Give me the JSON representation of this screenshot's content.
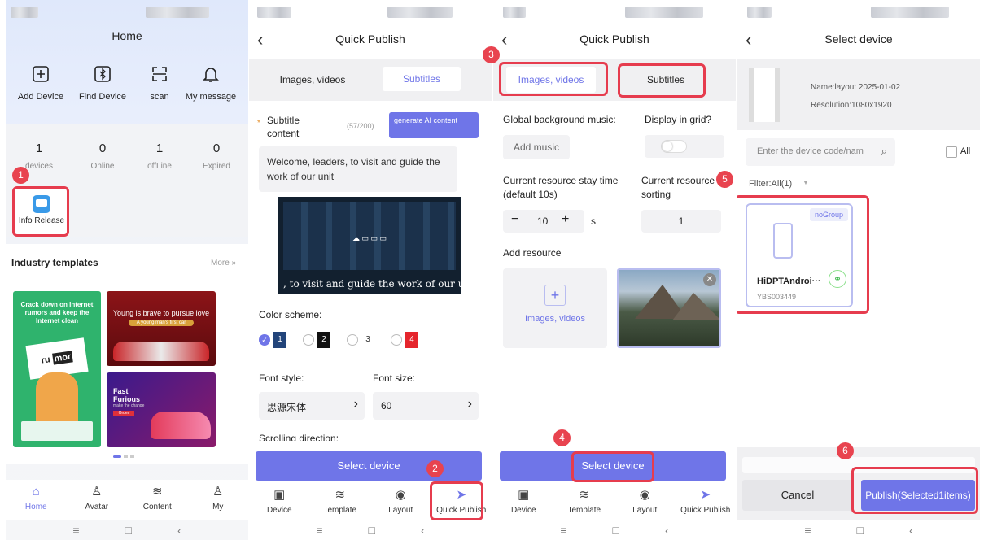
{
  "screen1": {
    "title": "Home",
    "actions": [
      {
        "label": "Add Device",
        "icon": "plus-square-icon"
      },
      {
        "label": "Find Device",
        "icon": "bluetooth-icon"
      },
      {
        "label": "scan",
        "icon": "scan-icon"
      },
      {
        "label": "My message",
        "icon": "bell-icon"
      }
    ],
    "stats": [
      {
        "value": "1",
        "label": "devices"
      },
      {
        "value": "0",
        "label": "Online"
      },
      {
        "value": "1",
        "label": "offLine"
      },
      {
        "value": "0",
        "label": "Expired"
      }
    ],
    "info_release": "Info Release",
    "industry_templates": "Industry templates",
    "more": "More »",
    "template1_text": "Crack down on Internet rumors and keep the Internet clean",
    "template1_word1": "ru",
    "template1_word2": "mor",
    "template2_text": "Young is brave to pursue love",
    "template2_sub": "A young man's first car",
    "template3_text1": "Fast",
    "template3_text2": "Furious",
    "template3_sub": "make the change",
    "template3_btn": "Order",
    "tabs": [
      "Home",
      "Avatar",
      "Content",
      "My"
    ]
  },
  "screen2": {
    "title": "Quick Publish",
    "tab_images": "Images, videos",
    "tab_subtitles": "Subtitles",
    "subtitle_label": "Subtitle content",
    "char_count": "(57/200)",
    "ai_button": "generate AI content",
    "subtitle_text": "Welcome, leaders, to visit and guide the work of our unit",
    "preview_caption": ", to visit and guide the work of our uni",
    "color_scheme": "Color scheme:",
    "color_options": [
      "1",
      "2",
      "3",
      "4"
    ],
    "font_style_label": "Font style:",
    "font_style_value": "思源宋体",
    "font_size_label": "Font size:",
    "font_size_value": "60",
    "scrolling_label": "Scrolling direction:",
    "select_device": "Select device",
    "tabs": [
      "Device",
      "Template",
      "Layout",
      "Quick Publish"
    ]
  },
  "screen3": {
    "title": "Quick Publish",
    "tab_images": "Images, videos",
    "tab_subtitles": "Subtitles",
    "bg_music": "Global background music:",
    "add_music": "Add music",
    "display_grid": "Display in grid?",
    "stay_time": "Current resource stay time (default 10s)",
    "stay_value": "10",
    "stay_unit": "s",
    "sorting": "Current resource sorting",
    "sorting_value": "1",
    "add_resource": "Add resource",
    "upload_label": "Images, videos",
    "select_device": "Select device",
    "tabs": [
      "Device",
      "Template",
      "Layout",
      "Quick Publish"
    ]
  },
  "screen4": {
    "title": "Select device",
    "layout_name": "Name:layout 2025-01-02",
    "resolution": "Resolution:1080x1920",
    "search_placeholder": "Enter the device code/nam",
    "all": "All",
    "filter": "Filter:All(1)",
    "group": "noGroup",
    "device_name": "HiDPTAndroi···",
    "device_code": "YBS003449",
    "cancel": "Cancel",
    "publish": "Publish(Selected1items)"
  },
  "badges": [
    "1",
    "2",
    "3",
    "4",
    "5",
    "6"
  ],
  "colors": {
    "accent": "#6f75e8",
    "highlight": "#e63c4e"
  }
}
